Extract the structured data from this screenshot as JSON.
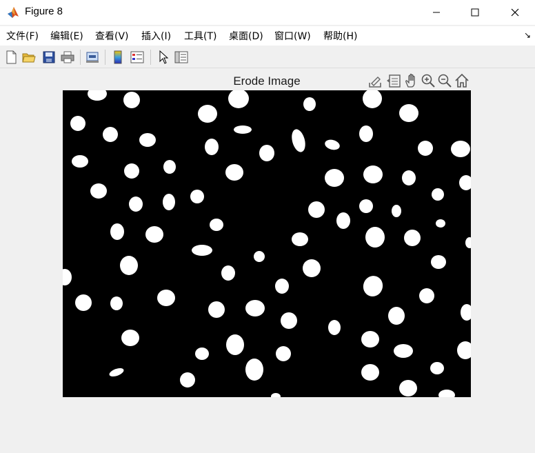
{
  "window": {
    "title": "Figure 8"
  },
  "menu": [
    "文件(F)",
    "编辑(E)",
    "查看(V)",
    "插入(I)",
    "工具(T)",
    "桌面(D)",
    "窗口(W)",
    "帮助(H)"
  ],
  "toolbar": [
    "new-figure-icon",
    "open-file-icon",
    "save-icon",
    "print-icon",
    "link-plot-icon",
    "insert-colorbar-icon",
    "insert-legend-icon",
    "edit-plot-icon",
    "property-inspector-icon"
  ],
  "axes": {
    "title": "Erode Image"
  },
  "colors": {
    "image_background": "#000000",
    "blob": "#ffffff",
    "figure_background": "#f0f0f0"
  }
}
